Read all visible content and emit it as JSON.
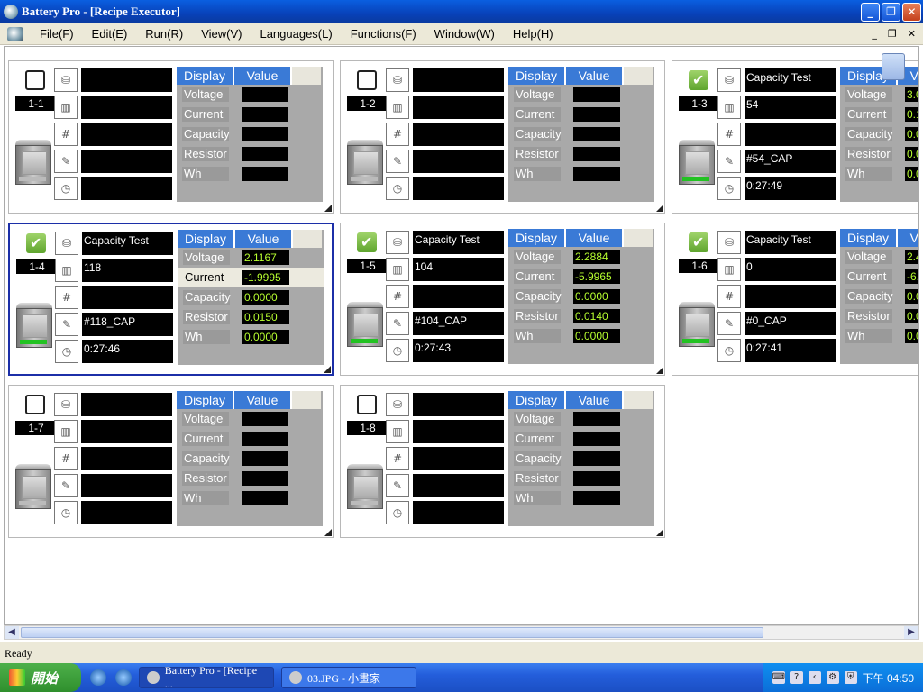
{
  "window": {
    "title": "Battery Pro - [Recipe Executor]",
    "min": "_",
    "restore": "❐",
    "close": "✕"
  },
  "menu": [
    "File(F)",
    "Edit(E)",
    "Run(R)",
    "View(V)",
    "Languages(L)",
    "Functions(F)",
    "Window(W)",
    "Help(H)"
  ],
  "mdi_controls": [
    "_",
    "❐",
    "✕"
  ],
  "panel_headers": {
    "display": "Display",
    "value": "Value"
  },
  "row_labels": [
    "Voltage",
    "Current",
    "Capacity",
    "Resistor",
    "Wh"
  ],
  "channels": [
    {
      "id": "1-1",
      "checked": false,
      "selected": false,
      "fields": [
        "",
        "",
        "",
        "",
        ""
      ],
      "values": [
        "",
        "",
        "",
        "",
        ""
      ],
      "active": false
    },
    {
      "id": "1-2",
      "checked": false,
      "selected": false,
      "fields": [
        "",
        "",
        "",
        "",
        ""
      ],
      "values": [
        "",
        "",
        "",
        "",
        ""
      ],
      "active": false
    },
    {
      "id": "1-3",
      "checked": true,
      "selected": false,
      "fields": [
        "Capacity Test",
        "54",
        "",
        "#54_CAP",
        "0:27:49"
      ],
      "values": [
        "3.0",
        "0.1",
        "0.0",
        "0.0",
        "0.0"
      ],
      "active": true
    },
    {
      "id": "1-4",
      "checked": true,
      "selected": true,
      "fields": [
        "Capacity Test",
        "118",
        "",
        "#118_CAP",
        "0:27:46"
      ],
      "values": [
        "2.1167",
        "-1.9995",
        "0.0000",
        "0.0150",
        "0.0000"
      ],
      "active": true
    },
    {
      "id": "1-5",
      "checked": true,
      "selected": false,
      "fields": [
        "Capacity Test",
        "104",
        "",
        "#104_CAP",
        "0:27:43"
      ],
      "values": [
        "2.2884",
        "-5.9965",
        "0.0000",
        "0.0140",
        "0.0000"
      ],
      "active": true
    },
    {
      "id": "1-6",
      "checked": true,
      "selected": false,
      "fields": [
        "Capacity Test",
        "0",
        "",
        "#0_CAP",
        "0:27:41"
      ],
      "values": [
        "2.4",
        "-6.",
        "0.0",
        "0.0",
        "0.0"
      ],
      "active": true
    },
    {
      "id": "1-7",
      "checked": false,
      "selected": false,
      "fields": [
        "",
        "",
        "",
        "",
        ""
      ],
      "values": [
        "",
        "",
        "",
        "",
        ""
      ],
      "active": false
    },
    {
      "id": "1-8",
      "checked": false,
      "selected": false,
      "fields": [
        "",
        "",
        "",
        "",
        ""
      ],
      "values": [
        "",
        "",
        "",
        "",
        ""
      ],
      "active": false
    }
  ],
  "field_icons": [
    "database-icon",
    "barcode-icon",
    "hash-icon",
    "recipe-icon",
    "clock-icon"
  ],
  "field_glyphs": [
    "⛁",
    "▥",
    "#",
    "✎",
    "◷"
  ],
  "status": {
    "text": "Ready"
  },
  "taskbar": {
    "start_label": "開始",
    "tasks": [
      {
        "label": "Battery Pro - [Recipe ..."
      },
      {
        "label": "03.JPG - 小畫家"
      }
    ],
    "clock": "下午 04:50"
  }
}
